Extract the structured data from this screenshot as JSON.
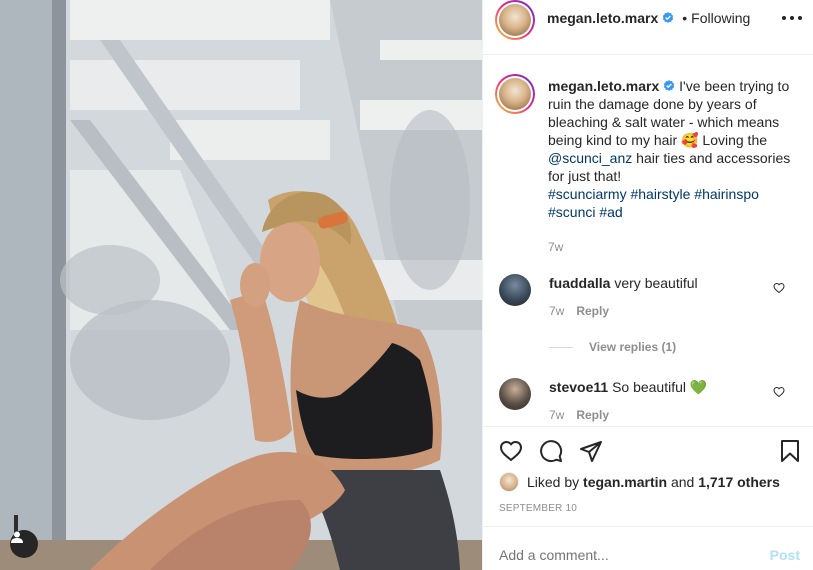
{
  "post": {
    "username": "megan.leto.marx",
    "dot": "•",
    "follow_status": "Following"
  },
  "caption": {
    "username": "megan.leto.marx",
    "text_1": " I've been trying to ruin the damage done by years of bleaching & salt water - which means being kind to my hair ",
    "emoji": "🥰",
    "text_2": " Loving the ",
    "mention": "@scunci_anz",
    "text_3": " hair ties and accessories for just that!",
    "hashtags": [
      "#scunciarmy",
      "#hairstyle",
      "#hairinspo",
      "#scunci",
      "#ad"
    ],
    "time": "7w"
  },
  "comments": [
    {
      "username": "fuaddalla",
      "text": "very beautiful",
      "time": "7w",
      "reply_label": "Reply"
    },
    {
      "username": "stevoe11",
      "text": "So beautiful",
      "emoji": "💚",
      "time": "7w",
      "reply_label": "Reply"
    }
  ],
  "view_replies": "View replies (1)",
  "likes": {
    "prefix": "Liked by",
    "user": "tegan.martin",
    "middle": "and",
    "others": "1,717 others"
  },
  "date": "SEPTEMBER 10",
  "add_comment": {
    "placeholder": "Add a comment...",
    "post_label": "Post"
  },
  "icons": {
    "more": "more-options-icon",
    "verified": "verified-badge-icon",
    "like": "heart-icon",
    "comment": "comment-icon",
    "share": "share-icon",
    "save": "bookmark-icon",
    "tag": "user-tag-icon"
  },
  "colors": {
    "verified": "#3897f0",
    "link": "#00376b",
    "muted": "#8e8e8e",
    "post_disabled": "#b2dffc"
  }
}
